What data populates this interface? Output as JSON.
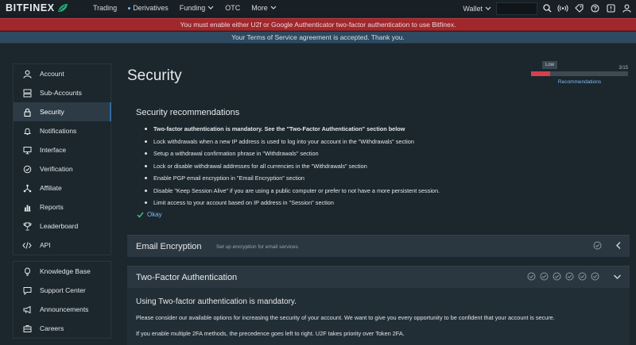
{
  "brand": {
    "name": "BITFINEX",
    "accent": "#22b37a"
  },
  "nav": {
    "items": [
      {
        "label": "Trading"
      },
      {
        "label": "Derivatives"
      },
      {
        "label": "Funding"
      },
      {
        "label": "OTC"
      },
      {
        "label": "More"
      }
    ],
    "wallet_label": "Wallet",
    "search_placeholder": ""
  },
  "banners": {
    "error": "You must enable either U2f or Google Authenticator two-factor authentication to use Bitfinex.",
    "info": "Your Terms of Service agreement is accepted. Thank you."
  },
  "sidebar": {
    "main": [
      {
        "label": "Account",
        "icon": "user-icon"
      },
      {
        "label": "Sub-Accounts",
        "icon": "sub-accounts-icon"
      },
      {
        "label": "Security",
        "icon": "lock-icon",
        "active": true
      },
      {
        "label": "Notifications",
        "icon": "bell-icon"
      },
      {
        "label": "Interface",
        "icon": "monitor-icon"
      },
      {
        "label": "Verification",
        "icon": "verified-check-icon"
      },
      {
        "label": "Affiliate",
        "icon": "affiliate-icon"
      },
      {
        "label": "Reports",
        "icon": "reports-icon"
      },
      {
        "label": "Leaderboard",
        "icon": "trophy-icon"
      },
      {
        "label": "API",
        "icon": "code-icon"
      }
    ],
    "secondary": [
      {
        "label": "Knowledge Base",
        "icon": "lightbulb-icon"
      },
      {
        "label": "Support Center",
        "icon": "support-chat-icon"
      },
      {
        "label": "Announcements",
        "icon": "megaphone-icon"
      },
      {
        "label": "Careers",
        "icon": "briefcase-icon"
      }
    ]
  },
  "page": {
    "title": "Security",
    "score": {
      "tag": "Low",
      "value": 3,
      "max": 15,
      "fraction_text": "3/15",
      "link": "Recommendations",
      "color": "#d63f4d"
    }
  },
  "recommendations": {
    "title": "Security recommendations",
    "items": [
      {
        "text": "Two-factor authentication is mandatory. See the \"Two-Factor Authentication\" section below",
        "bold": true
      },
      {
        "text": "Lock withdrawals when a new IP address is used to log into your account in the \"Withdrawals\" section"
      },
      {
        "text": "Setup a withdrawal confirmation phrase in \"Withdrawals\" section"
      },
      {
        "text": "Lock or disable withdrawal addresses for all currencies in the \"Withdrawals\" section"
      },
      {
        "text": "Enable PGP email encryption in \"Email Encryption\" section"
      },
      {
        "text": "Disable \"Keep Session Alive\" if you are using a public computer or prefer to not have a more persistent session."
      },
      {
        "text": "Limit access to your account based on IP address in \"Session\" section"
      }
    ],
    "okay_label": "Okay"
  },
  "sections": {
    "email": {
      "title": "Email Encryption",
      "description": "Set up encryption for email services"
    },
    "twofa": {
      "title": "Two-Factor Authentication",
      "heading": "Using Two-factor authentication is mandatory.",
      "p1": "Please consider our available options for increasing the security of your account. We want to give you every opportunity to be confident that your account is secure.",
      "p2": "If you enable multiple 2FA methods, the precedence goes left to right. U2F takes priority over Token 2FA."
    }
  }
}
